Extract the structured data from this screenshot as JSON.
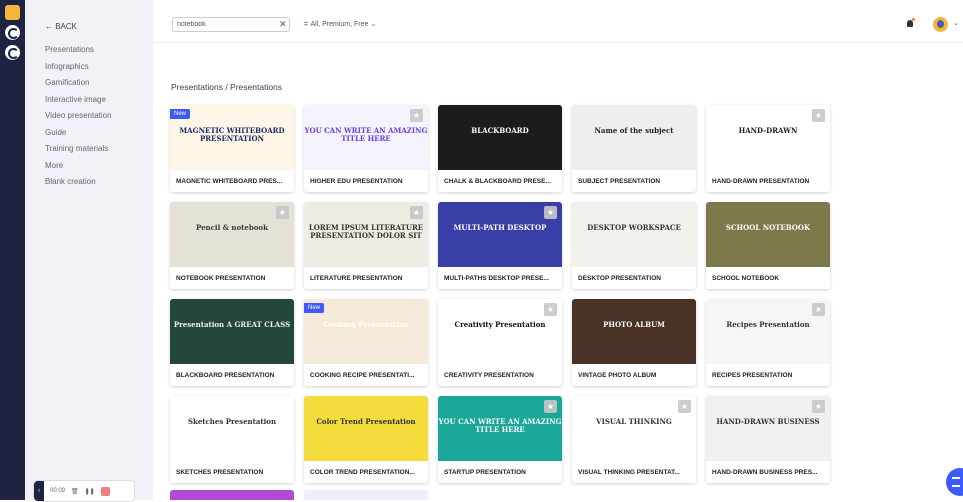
{
  "nav": {
    "back_label": "← BACK",
    "items": [
      "Presentations",
      "Infographics",
      "Gamification",
      "Interactive image",
      "Video presentation",
      "Guide",
      "Training materials",
      "More",
      "Blank creation"
    ]
  },
  "recorder": {
    "time": "00:09"
  },
  "search": {
    "value": "notebook",
    "clear_icon": "close-icon"
  },
  "filter": {
    "label": "All, Premium, Free"
  },
  "breadcrumb": "Presentations / Presentations",
  "colors": {
    "rail": "#1d2341",
    "sidebar": "#f1f1f8",
    "accent": "#3d5afe",
    "new_badge": "#3d5afe"
  },
  "cards": [
    {
      "label": "MAGNETIC WHITEBOARD PRES...",
      "thumb_text": "MAGNETIC WHITEBOARD PRESENTATION",
      "bg": "#fdf6e6",
      "fg": "#1e2a6a",
      "new": true,
      "star": false
    },
    {
      "label": "HIGHER EDU PRESENTATION",
      "thumb_text": "YOU CAN WRITE AN AMAZING TITLE HERE",
      "bg": "#f4f2fb",
      "fg": "#6a3de8",
      "new": false,
      "star": true
    },
    {
      "label": "CHALK & BLACKBOARD PRESE...",
      "thumb_text": "BLACKBOARD",
      "bg": "#1c1c1c",
      "fg": "#ffffff",
      "new": false,
      "star": false
    },
    {
      "label": "SUBJECT PRESENTATION",
      "thumb_text": "Name of the subject",
      "bg": "#eeeeee",
      "fg": "#222222",
      "new": false,
      "star": false
    },
    {
      "label": "HAND-DRAWN PRESENTATION",
      "thumb_text": "HAND-DRAWN",
      "bg": "#ffffff",
      "fg": "#222222",
      "new": false,
      "star": true
    },
    {
      "label": "NOTEBOOK PRESENTATION",
      "thumb_text": "Pencil & notebook",
      "bg": "#e6e1d6",
      "fg": "#3a3a3a",
      "new": false,
      "star": true
    },
    {
      "label": "LITERATURE PRESENTATION",
      "thumb_text": "LOREM IPSUM LITERATURE PRESENTATION DOLOR SIT",
      "bg": "#f1ece3",
      "fg": "#333333",
      "new": false,
      "star": true
    },
    {
      "label": "MULTI-PATHS DESKTOP PRESE...",
      "thumb_text": "MULTI-PATH DESKTOP",
      "bg": "#3a3fa8",
      "fg": "#ffffff",
      "new": false,
      "star": true
    },
    {
      "label": "DESKTOP PRESENTATION",
      "thumb_text": "DESKTOP WORKSPACE",
      "bg": "#f3f1ec",
      "fg": "#333333",
      "new": false,
      "star": false
    },
    {
      "label": "SCHOOL NOTEBOOK",
      "thumb_text": "SCHOOL NOTEBOOK",
      "bg": "#7c7a4a",
      "fg": "#ffffff",
      "new": false,
      "star": false
    },
    {
      "label": "BLACKBOARD PRESENTATION",
      "thumb_text": "Presentation A GREAT CLASS",
      "bg": "#24473b",
      "fg": "#f1f1e6",
      "new": false,
      "star": false
    },
    {
      "label": "COOKING RECIPE PRESENTATI...",
      "thumb_text": "Cooking Presentation",
      "bg": "#f5ead9",
      "fg": "#ffffff",
      "new": true,
      "star": false
    },
    {
      "label": "CREATIVITY PRESENTATION",
      "thumb_text": "Creativity Presentation",
      "bg": "#ffffff",
      "fg": "#111111",
      "new": false,
      "star": true
    },
    {
      "label": "VINTAGE PHOTO ALBUM",
      "thumb_text": "PHOTO ALBUM",
      "bg": "#4a3326",
      "fg": "#ffffff",
      "new": false,
      "star": false
    },
    {
      "label": "RECIPES PRESENTATION",
      "thumb_text": "Recipes Presentation",
      "bg": "#f6f6f6",
      "fg": "#333333",
      "new": false,
      "star": true
    },
    {
      "label": "SKETCHES PRESENTATION",
      "thumb_text": "Sketches Presentation",
      "bg": "#ffffff",
      "fg": "#333333",
      "new": false,
      "star": false
    },
    {
      "label": "COLOR TREND PRESENTATION...",
      "thumb_text": "Color Trend Presentation",
      "bg": "#f4dc3c",
      "fg": "#333333",
      "new": false,
      "star": false
    },
    {
      "label": "STARTUP PRESENTATION",
      "thumb_text": "YOU CAN WRITE AN AMAZING TITLE HERE",
      "bg": "#1aa79a",
      "fg": "#ffffff",
      "new": false,
      "star": true
    },
    {
      "label": "VISUAL THINKING PRESENTAT...",
      "thumb_text": "VISUAL THINKING",
      "bg": "#ffffff",
      "fg": "#333333",
      "new": false,
      "star": true
    },
    {
      "label": "HAND-DRAWN BUSINESS PRES...",
      "thumb_text": "HAND-DRAWN BUSINESS",
      "bg": "#f0f0f0",
      "fg": "#333333",
      "new": false,
      "star": true
    }
  ]
}
